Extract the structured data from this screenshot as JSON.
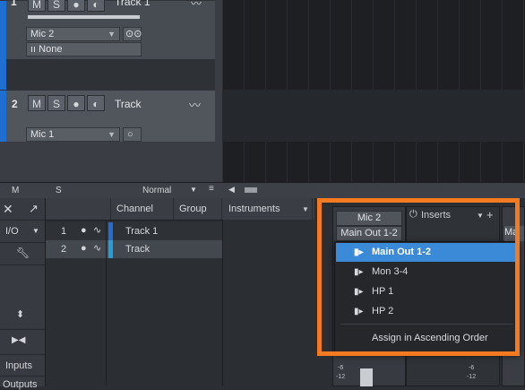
{
  "tracks": [
    {
      "number": "1",
      "name": "Track 1",
      "mute": "M",
      "solo": "S",
      "input": "Mic 2",
      "output": "None"
    },
    {
      "number": "2",
      "name": "Track",
      "mute": "M",
      "solo": "S",
      "input": "Mic 1"
    }
  ],
  "bottom_bar": {
    "m": "M",
    "s": "S",
    "mode": "Normal"
  },
  "left_nav": {
    "io": "I/O",
    "inputs": "Inputs",
    "outputs": "Outputs"
  },
  "list_headers": {
    "channel": "Channel",
    "group": "Group",
    "instruments": "Instruments"
  },
  "channel_list": [
    {
      "index": "1",
      "name": "Track 1"
    },
    {
      "index": "2",
      "name": "Track"
    }
  ],
  "mixer_strip": {
    "input": "Mic 2",
    "output": "Main Out 1-2",
    "inserts": "Inserts",
    "meter_a": "-6",
    "meter_b": "-12",
    "meter_c": "-6",
    "meter_d": "-12",
    "partial_label": "Ma"
  },
  "output_menu": {
    "items": [
      {
        "label": "Main Out 1-2",
        "selected": true
      },
      {
        "label": "Mon 3-4",
        "selected": false
      },
      {
        "label": "HP 1",
        "selected": false
      },
      {
        "label": "HP 2",
        "selected": false
      }
    ],
    "assign_label": "Assign in Ascending Order"
  },
  "colors": {
    "highlight": "#3b8ad8",
    "annotation": "#f37a20",
    "track_color": "#1f6fd3"
  }
}
